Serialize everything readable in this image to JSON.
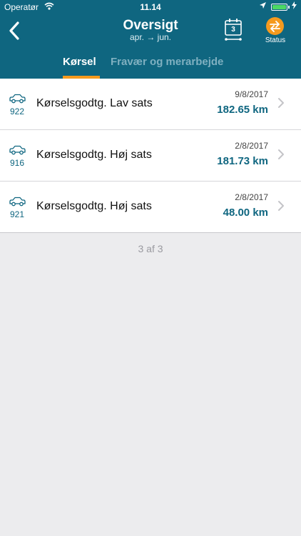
{
  "statusbar": {
    "carrier": "Operatør",
    "time": "11.14"
  },
  "header": {
    "title": "Oversigt",
    "subtitle": "apr. → jun.",
    "calendar_day": "3",
    "status_label": "Status"
  },
  "tabs": {
    "active": "Kørsel",
    "inactive": "Fravær og merarbejde"
  },
  "rows": [
    {
      "num": "922",
      "label": "Kørselsgodtg. Lav sats",
      "date": "9/8/2017",
      "km": "182.65 km"
    },
    {
      "num": "916",
      "label": "Kørselsgodtg. Høj sats",
      "date": "2/8/2017",
      "km": "181.73 km"
    },
    {
      "num": "921",
      "label": "Kørselsgodtg. Høj sats",
      "date": "2/8/2017",
      "km": "48.00 km"
    }
  ],
  "pager": "3 af 3",
  "colors": {
    "header_bg": "#0f6680",
    "accent": "#f59a1e"
  }
}
